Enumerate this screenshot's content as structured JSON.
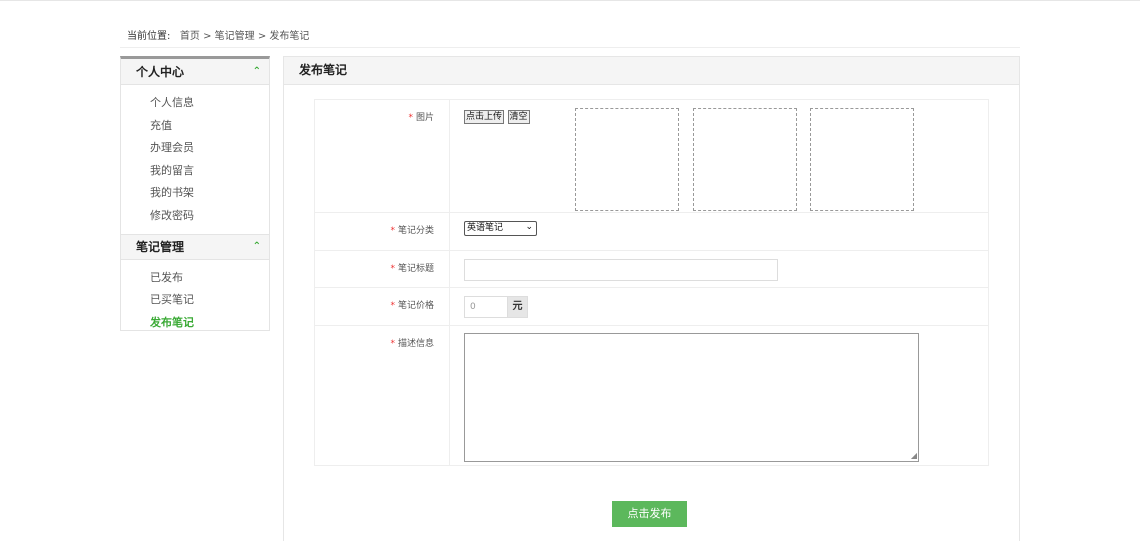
{
  "breadcrumb": {
    "label": "当前位置:",
    "path": "首页 > 笔记管理 > 发布笔记"
  },
  "sidebar": {
    "sections": [
      {
        "title": "个人中心",
        "items": [
          "个人信息",
          "充值",
          "办理会员",
          "我的留言",
          "我的书架",
          "修改密码"
        ]
      },
      {
        "title": "笔记管理",
        "items": [
          "已发布",
          "已买笔记",
          "发布笔记"
        ],
        "active": "发布笔记"
      }
    ]
  },
  "panel": {
    "title": "发布笔记"
  },
  "form": {
    "required_mark": "*",
    "image": {
      "label": "图片",
      "upload_label": "点击上传",
      "clear_label": "清空",
      "slot_count": 3
    },
    "category": {
      "label": "笔记分类",
      "selected": "英语笔记"
    },
    "title": {
      "label": "笔记标题",
      "value": ""
    },
    "price": {
      "label": "笔记价格",
      "placeholder": "0",
      "unit": "元"
    },
    "description": {
      "label": "描述信息",
      "value": ""
    },
    "submit_label": "点击发布"
  },
  "colors": {
    "accent": "#3aaa35",
    "button": "#5cb85c",
    "required": "#ee3333"
  },
  "icons": {
    "expand": "chevron-up-icon",
    "select": "chevron-down-icon"
  }
}
